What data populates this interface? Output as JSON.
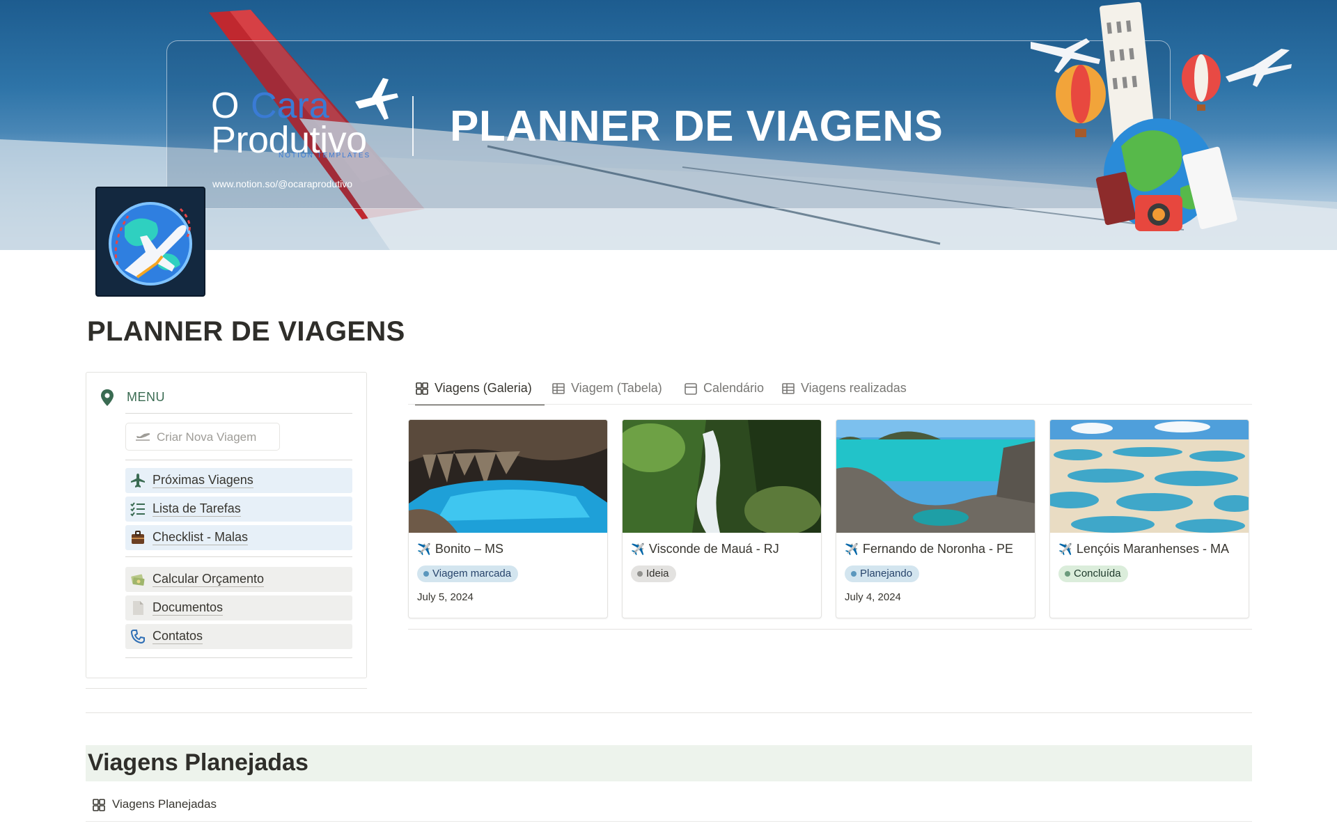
{
  "cover": {
    "brand_o": "O",
    "brand_cara": "Cara",
    "brand_produtivo": "Produtivo",
    "brand_sub": "NOTION TEMPLATES",
    "banner_title": "PLANNER DE VIAGENS",
    "url": "www.notion.so/@ocaraprodutivo"
  },
  "page": {
    "title": "PLANNER DE VIAGENS",
    "icon": "globe-plane-icon"
  },
  "menu": {
    "header": "MENU",
    "header_icon": "map-pin-icon",
    "new_trip_button": "Criar Nova Viagem",
    "new_trip_icon": "plane-takeoff-icon",
    "items_primary": [
      {
        "label": "Próximas Viagens",
        "icon": "airplane-icon"
      },
      {
        "label": "Lista de Tarefas",
        "icon": "checklist-icon"
      },
      {
        "label": "Checklist - Malas",
        "icon": "suitcase-icon"
      }
    ],
    "items_secondary": [
      {
        "label": "Calcular Orçamento",
        "icon": "money-icon"
      },
      {
        "label": "Documentos",
        "icon": "document-icon"
      },
      {
        "label": "Contatos",
        "icon": "phone-icon"
      }
    ]
  },
  "tabs": [
    {
      "label": "Viagens (Galeria)",
      "icon": "gallery-icon",
      "active": true
    },
    {
      "label": "Viagem (Tabela)",
      "icon": "table-icon",
      "active": false
    },
    {
      "label": "Calendário",
      "icon": "calendar-icon",
      "active": false
    },
    {
      "label": "Viagens realizadas",
      "icon": "table-icon",
      "active": false
    }
  ],
  "cards": [
    {
      "title": "Bonito – MS",
      "status": "Viagem marcada",
      "status_color": "blue",
      "date": "July 5, 2024",
      "image": "blue-cave-lake"
    },
    {
      "title": "Visconde de Mauá - RJ",
      "status": "Ideia",
      "status_color": "gray",
      "date": "",
      "image": "waterfall-forest"
    },
    {
      "title": "Fernando de Noronha - PE",
      "status": "Planejando",
      "status_color": "blue",
      "date": "July 4, 2024",
      "image": "tropical-beach-rocks"
    },
    {
      "title": "Lençóis Maranhenses - MA",
      "status": "Concluída",
      "status_color": "green",
      "date": "",
      "image": "sand-dunes-lagoons"
    }
  ],
  "section": {
    "heading": "Viagens Planejadas",
    "view_label": "Viagens Planejadas",
    "view_icon": "gallery-icon"
  },
  "colors": {
    "accent_green": "#3a6b52",
    "section_bg": "#edf3ec",
    "menu_blue_bg": "#e7f0f8",
    "menu_gray_bg": "#efefed"
  }
}
